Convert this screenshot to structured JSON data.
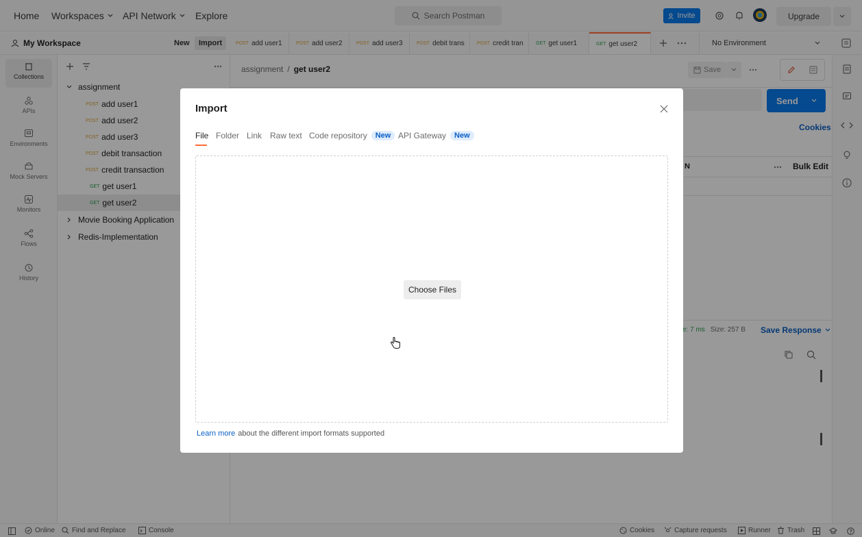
{
  "topbar": {
    "nav": [
      "Home",
      "Workspaces",
      "API Network",
      "Explore"
    ],
    "search_placeholder": "Search Postman",
    "invite": "Invite",
    "upgrade": "Upgrade"
  },
  "workspace": {
    "name": "My Workspace",
    "new_label": "New",
    "import_label": "Import",
    "environment": "No Environment"
  },
  "tabs": [
    {
      "method": "POST",
      "label": "add user1"
    },
    {
      "method": "POST",
      "label": "add user2"
    },
    {
      "method": "POST",
      "label": "add user3"
    },
    {
      "method": "POST",
      "label": "debit trans"
    },
    {
      "method": "POST",
      "label": "credit tran"
    },
    {
      "method": "GET",
      "label": "get user1"
    },
    {
      "method": "GET",
      "label": "get user2"
    }
  ],
  "rail": [
    "Collections",
    "APIs",
    "Environments",
    "Mock Servers",
    "Monitors",
    "Flows",
    "History"
  ],
  "tree": {
    "collection": "assignment",
    "requests": [
      {
        "method": "POST",
        "label": "add user1"
      },
      {
        "method": "POST",
        "label": "add user2"
      },
      {
        "method": "POST",
        "label": "add user3"
      },
      {
        "method": "POST",
        "label": "debit transaction"
      },
      {
        "method": "POST",
        "label": "credit transaction"
      },
      {
        "method": "GET",
        "label": "get user1"
      },
      {
        "method": "GET",
        "label": "get user2"
      }
    ],
    "other_collections": [
      "Movie Booking Application",
      "Redis-Implementation"
    ]
  },
  "main": {
    "breadcrumb_parent": "assignment",
    "breadcrumb_sep": "/",
    "breadcrumb_current": "get user2",
    "save_label": "Save",
    "send_label": "Send",
    "cookies_label": "Cookies",
    "bulk_edit": "Bulk Edit",
    "col_fragment": "N",
    "time_fragment": "e: 7 ms",
    "size": "Size: 257 B",
    "save_response": "Save Response"
  },
  "statusbar": {
    "online": "Online",
    "find_replace": "Find and Replace",
    "console": "Console",
    "cookies": "Cookies",
    "capture": "Capture requests",
    "runner": "Runner",
    "trash": "Trash"
  },
  "modal": {
    "title": "Import",
    "tabs": [
      "File",
      "Folder",
      "Link",
      "Raw text",
      "Code repository",
      "API Gateway"
    ],
    "new_badge": "New",
    "choose_files": "Choose Files",
    "learn_more": "Learn more",
    "footer_text": "about the different import formats supported"
  },
  "colors": {
    "accent": "#097bed",
    "active_tab": "#ff6c37",
    "post": "#d9a33b",
    "get": "#2c9b4f"
  }
}
